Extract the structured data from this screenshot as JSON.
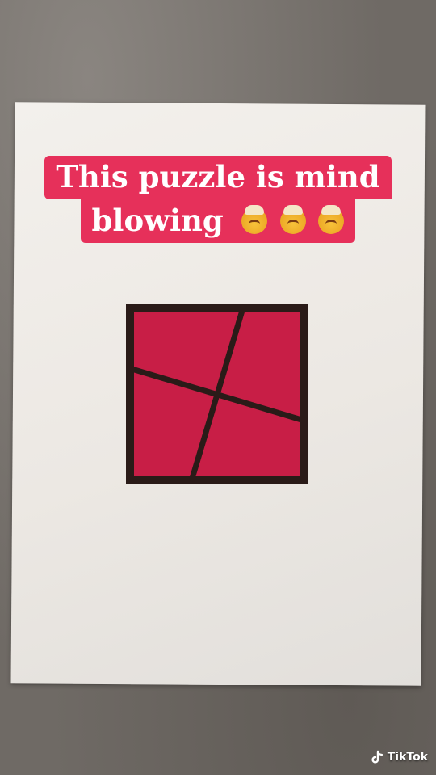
{
  "caption": {
    "line1": "This puzzle is mind",
    "line2": "blowing",
    "emoji": [
      "exploding-head-emoji",
      "exploding-head-emoji",
      "exploding-head-emoji"
    ]
  },
  "puzzle": {
    "fill_color": "#c81e46",
    "border_color": "#2a1b18"
  },
  "watermark": {
    "brand": "TikTok"
  },
  "colors": {
    "caption_bg": "#e6305a",
    "caption_text": "#ffffff",
    "paper": "#efebe6",
    "table": "#6f6a65"
  }
}
